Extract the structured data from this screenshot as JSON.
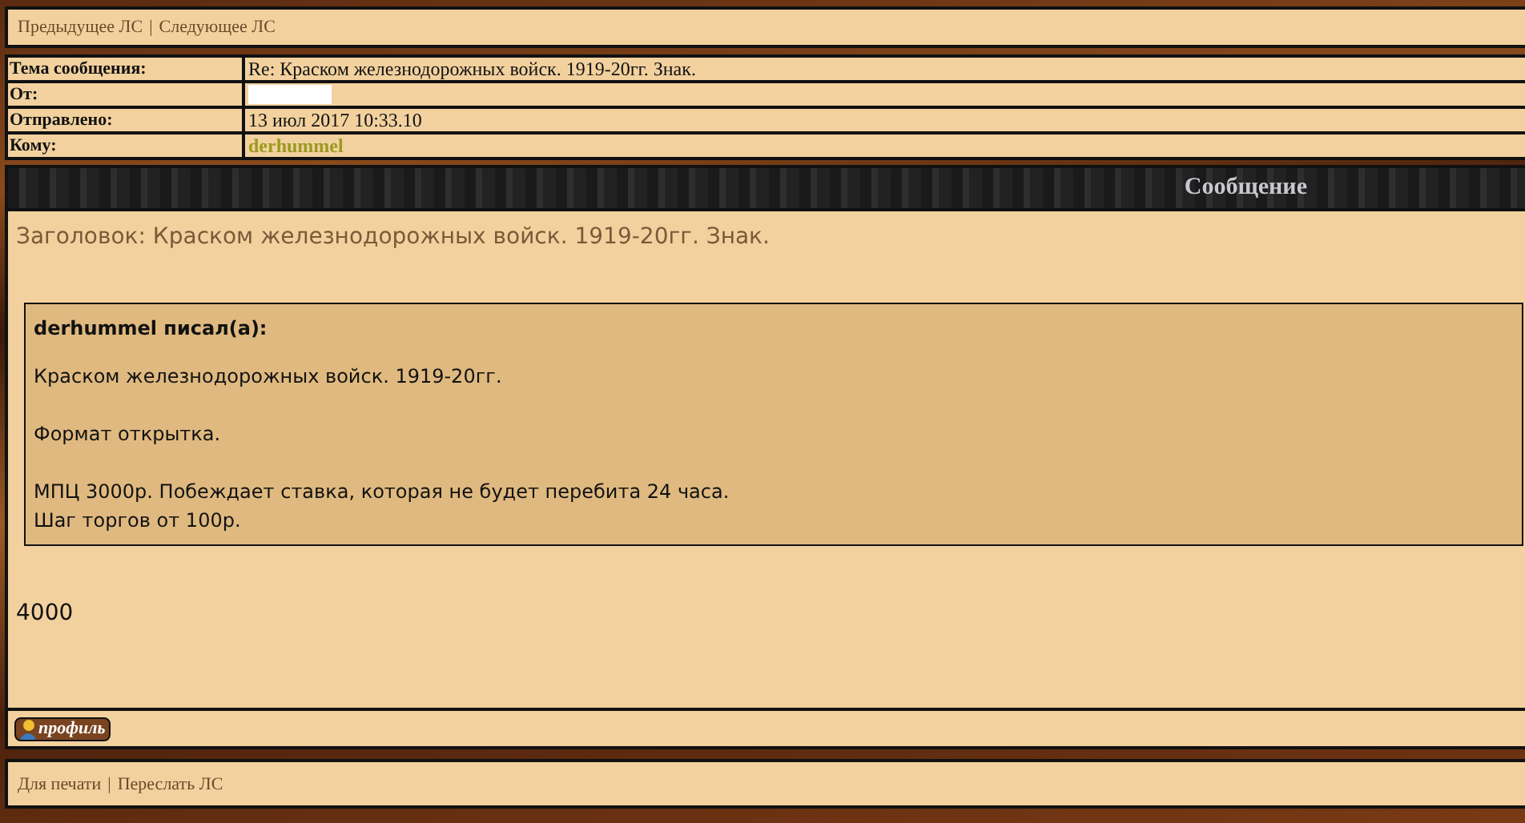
{
  "nav": {
    "links": [
      "Предыдущее ЛС",
      "Следующее ЛС"
    ],
    "separator": "|"
  },
  "header": {
    "rows": [
      {
        "label": "Тема сообщения:",
        "value": "Re: Краском железнодорожных войск. 1919-20гг. Знак.",
        "kind": "text"
      },
      {
        "label": "От:",
        "kind": "hidden"
      },
      {
        "label": "Отправлено:",
        "value": "13 июл 2017 10:33.10",
        "kind": "text"
      },
      {
        "label": "Кому:",
        "value": "derhummel",
        "kind": "user"
      }
    ]
  },
  "message_bar": {
    "title": "Сообщение"
  },
  "message": {
    "subject": "Заголовок: Краском железнодорожных войск. 1919-20гг. Знак.",
    "quote": {
      "author": "derhummel писал(а):",
      "paragraphs": [
        [
          "Краском железнодорожных войск. 1919-20гг."
        ],
        [
          "Формат открытка."
        ],
        [
          "МПЦ 3000р. Побеждает ставка, которая не будет перебита 24 часа.",
          "Шаг торгов от 100р."
        ]
      ]
    },
    "body": "4000"
  },
  "profile_button": {
    "label": "профиль"
  },
  "footer": {
    "links": [
      "Для печати",
      "Переслать ЛС"
    ],
    "separator": "|"
  }
}
